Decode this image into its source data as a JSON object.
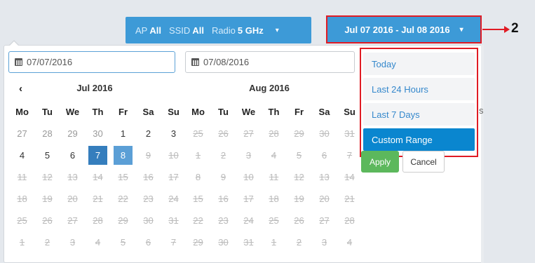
{
  "filter": {
    "ap_label": "AP",
    "ap_value": "All",
    "ssid_label": "SSID",
    "ssid_value": "All",
    "radio_label": "Radio",
    "radio_value": "5 GHz",
    "caret": "▾"
  },
  "date_range_button": {
    "label": "Jul 07 2016 - Jul 08 2016",
    "caret": "▾"
  },
  "callout": {
    "number": "2"
  },
  "inputs": {
    "start": "07/07/2016",
    "end": "07/08/2016"
  },
  "calendar_left": {
    "month": "Jul 2016",
    "prev": "‹",
    "weekdays": [
      "Mo",
      "Tu",
      "We",
      "Th",
      "Fr",
      "Sa",
      "Su"
    ],
    "weeks": [
      [
        "27",
        "28",
        "29",
        "30",
        "1",
        "2",
        "3"
      ],
      [
        "4",
        "5",
        "6",
        "7",
        "8",
        "9",
        "10"
      ],
      [
        "11",
        "12",
        "13",
        "14",
        "15",
        "16",
        "17"
      ],
      [
        "18",
        "19",
        "20",
        "21",
        "22",
        "23",
        "24"
      ],
      [
        "25",
        "26",
        "27",
        "28",
        "29",
        "30",
        "31"
      ],
      [
        "1",
        "2",
        "3",
        "4",
        "5",
        "6",
        "7"
      ]
    ]
  },
  "calendar_right": {
    "month": "Aug 2016",
    "weekdays": [
      "Mo",
      "Tu",
      "We",
      "Th",
      "Fr",
      "Sa",
      "Su"
    ],
    "weeks": [
      [
        "25",
        "26",
        "27",
        "28",
        "29",
        "30",
        "31"
      ],
      [
        "1",
        "2",
        "3",
        "4",
        "5",
        "6",
        "7"
      ],
      [
        "8",
        "9",
        "10",
        "11",
        "12",
        "13",
        "14"
      ],
      [
        "15",
        "16",
        "17",
        "18",
        "19",
        "20",
        "21"
      ],
      [
        "22",
        "23",
        "24",
        "25",
        "26",
        "27",
        "28"
      ],
      [
        "29",
        "30",
        "31",
        "1",
        "2",
        "3",
        "4"
      ]
    ]
  },
  "ranges": [
    "Today",
    "Last 24 Hours",
    "Last 7 Days",
    "Custom Range"
  ],
  "buttons": {
    "apply": "Apply",
    "cancel": "Cancel"
  },
  "edge_text": "s",
  "colors": {
    "accent": "#3d9ad7",
    "selected": "#357ebd",
    "apply": "#5cb85c",
    "highlight": "#e01b24"
  }
}
